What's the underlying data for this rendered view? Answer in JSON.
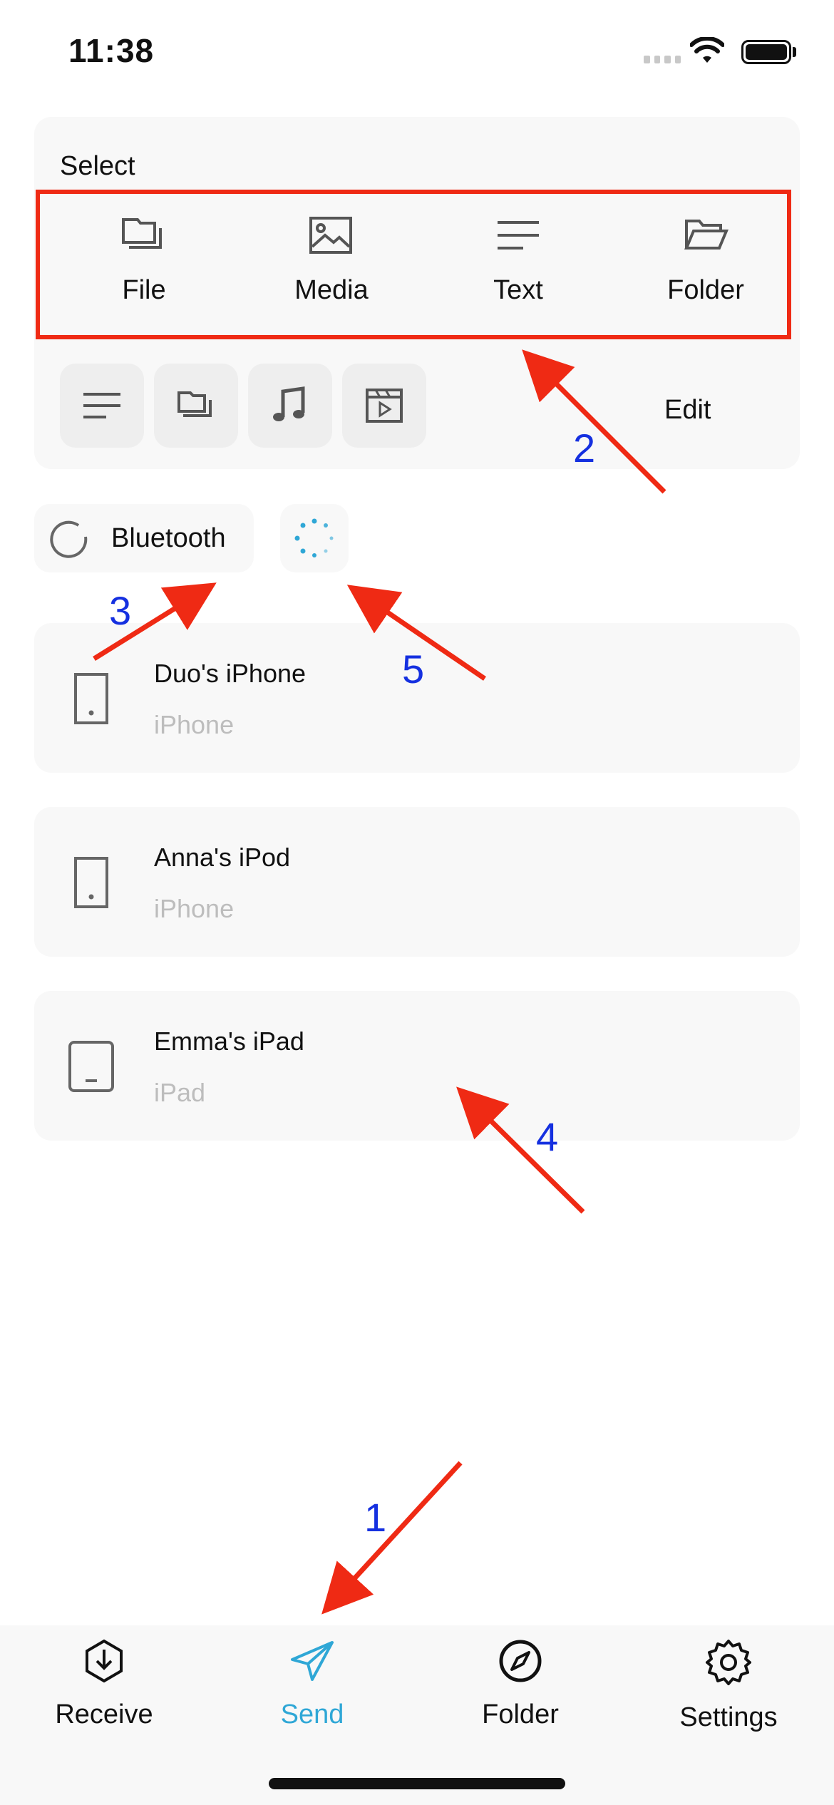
{
  "status_bar": {
    "time": "11:38"
  },
  "select_panel": {
    "title": "Select",
    "items": [
      {
        "label": "File",
        "icon": "file-stack-icon"
      },
      {
        "label": "Media",
        "icon": "image-icon"
      },
      {
        "label": "Text",
        "icon": "text-lines-icon"
      },
      {
        "label": "Folder",
        "icon": "folder-open-icon"
      }
    ],
    "quick_items": [
      "text-lines-icon",
      "file-stack-icon",
      "music-note-icon",
      "video-icon"
    ],
    "edit_label": "Edit"
  },
  "discovery": {
    "bluetooth_label": "Bluetooth"
  },
  "devices": [
    {
      "name": "Duo's iPhone",
      "type": "iPhone",
      "icon": "phone-icon"
    },
    {
      "name": "Anna's iPod",
      "type": "iPhone",
      "icon": "phone-icon"
    },
    {
      "name": "Emma's iPad",
      "type": "iPad",
      "icon": "tablet-icon"
    }
  ],
  "annotations": [
    "1",
    "2",
    "3",
    "4",
    "5"
  ],
  "tabs": [
    {
      "label": "Receive",
      "icon": "receive-icon",
      "active": false
    },
    {
      "label": "Send",
      "icon": "send-icon",
      "active": true
    },
    {
      "label": "Folder",
      "icon": "compass-icon",
      "active": false
    },
    {
      "label": "Settings",
      "icon": "gear-icon",
      "active": false
    }
  ],
  "colors": {
    "accent": "#2fa7d6",
    "annotation_arrow": "#ef2a14",
    "annotation_number": "#1530e0"
  }
}
